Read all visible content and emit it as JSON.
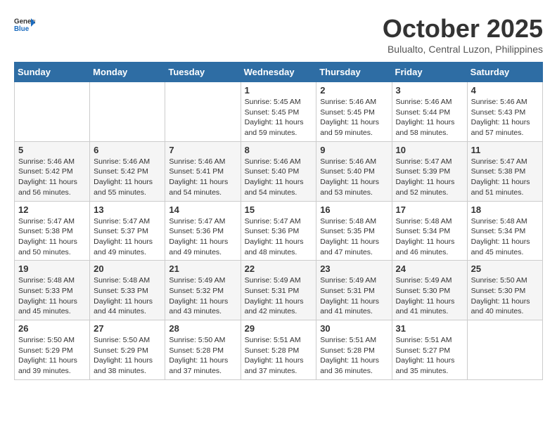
{
  "logo": {
    "general": "General",
    "blue": "Blue"
  },
  "title": "October 2025",
  "subtitle": "Bulualto, Central Luzon, Philippines",
  "weekdays": [
    "Sunday",
    "Monday",
    "Tuesday",
    "Wednesday",
    "Thursday",
    "Friday",
    "Saturday"
  ],
  "weeks": [
    [
      {
        "day": "",
        "info": ""
      },
      {
        "day": "",
        "info": ""
      },
      {
        "day": "",
        "info": ""
      },
      {
        "day": "1",
        "info": "Sunrise: 5:45 AM\nSunset: 5:45 PM\nDaylight: 11 hours\nand 59 minutes."
      },
      {
        "day": "2",
        "info": "Sunrise: 5:46 AM\nSunset: 5:45 PM\nDaylight: 11 hours\nand 59 minutes."
      },
      {
        "day": "3",
        "info": "Sunrise: 5:46 AM\nSunset: 5:44 PM\nDaylight: 11 hours\nand 58 minutes."
      },
      {
        "day": "4",
        "info": "Sunrise: 5:46 AM\nSunset: 5:43 PM\nDaylight: 11 hours\nand 57 minutes."
      }
    ],
    [
      {
        "day": "5",
        "info": "Sunrise: 5:46 AM\nSunset: 5:42 PM\nDaylight: 11 hours\nand 56 minutes."
      },
      {
        "day": "6",
        "info": "Sunrise: 5:46 AM\nSunset: 5:42 PM\nDaylight: 11 hours\nand 55 minutes."
      },
      {
        "day": "7",
        "info": "Sunrise: 5:46 AM\nSunset: 5:41 PM\nDaylight: 11 hours\nand 54 minutes."
      },
      {
        "day": "8",
        "info": "Sunrise: 5:46 AM\nSunset: 5:40 PM\nDaylight: 11 hours\nand 54 minutes."
      },
      {
        "day": "9",
        "info": "Sunrise: 5:46 AM\nSunset: 5:40 PM\nDaylight: 11 hours\nand 53 minutes."
      },
      {
        "day": "10",
        "info": "Sunrise: 5:47 AM\nSunset: 5:39 PM\nDaylight: 11 hours\nand 52 minutes."
      },
      {
        "day": "11",
        "info": "Sunrise: 5:47 AM\nSunset: 5:38 PM\nDaylight: 11 hours\nand 51 minutes."
      }
    ],
    [
      {
        "day": "12",
        "info": "Sunrise: 5:47 AM\nSunset: 5:38 PM\nDaylight: 11 hours\nand 50 minutes."
      },
      {
        "day": "13",
        "info": "Sunrise: 5:47 AM\nSunset: 5:37 PM\nDaylight: 11 hours\nand 49 minutes."
      },
      {
        "day": "14",
        "info": "Sunrise: 5:47 AM\nSunset: 5:36 PM\nDaylight: 11 hours\nand 49 minutes."
      },
      {
        "day": "15",
        "info": "Sunrise: 5:47 AM\nSunset: 5:36 PM\nDaylight: 11 hours\nand 48 minutes."
      },
      {
        "day": "16",
        "info": "Sunrise: 5:48 AM\nSunset: 5:35 PM\nDaylight: 11 hours\nand 47 minutes."
      },
      {
        "day": "17",
        "info": "Sunrise: 5:48 AM\nSunset: 5:34 PM\nDaylight: 11 hours\nand 46 minutes."
      },
      {
        "day": "18",
        "info": "Sunrise: 5:48 AM\nSunset: 5:34 PM\nDaylight: 11 hours\nand 45 minutes."
      }
    ],
    [
      {
        "day": "19",
        "info": "Sunrise: 5:48 AM\nSunset: 5:33 PM\nDaylight: 11 hours\nand 45 minutes."
      },
      {
        "day": "20",
        "info": "Sunrise: 5:48 AM\nSunset: 5:33 PM\nDaylight: 11 hours\nand 44 minutes."
      },
      {
        "day": "21",
        "info": "Sunrise: 5:49 AM\nSunset: 5:32 PM\nDaylight: 11 hours\nand 43 minutes."
      },
      {
        "day": "22",
        "info": "Sunrise: 5:49 AM\nSunset: 5:31 PM\nDaylight: 11 hours\nand 42 minutes."
      },
      {
        "day": "23",
        "info": "Sunrise: 5:49 AM\nSunset: 5:31 PM\nDaylight: 11 hours\nand 41 minutes."
      },
      {
        "day": "24",
        "info": "Sunrise: 5:49 AM\nSunset: 5:30 PM\nDaylight: 11 hours\nand 41 minutes."
      },
      {
        "day": "25",
        "info": "Sunrise: 5:50 AM\nSunset: 5:30 PM\nDaylight: 11 hours\nand 40 minutes."
      }
    ],
    [
      {
        "day": "26",
        "info": "Sunrise: 5:50 AM\nSunset: 5:29 PM\nDaylight: 11 hours\nand 39 minutes."
      },
      {
        "day": "27",
        "info": "Sunrise: 5:50 AM\nSunset: 5:29 PM\nDaylight: 11 hours\nand 38 minutes."
      },
      {
        "day": "28",
        "info": "Sunrise: 5:50 AM\nSunset: 5:28 PM\nDaylight: 11 hours\nand 37 minutes."
      },
      {
        "day": "29",
        "info": "Sunrise: 5:51 AM\nSunset: 5:28 PM\nDaylight: 11 hours\nand 37 minutes."
      },
      {
        "day": "30",
        "info": "Sunrise: 5:51 AM\nSunset: 5:28 PM\nDaylight: 11 hours\nand 36 minutes."
      },
      {
        "day": "31",
        "info": "Sunrise: 5:51 AM\nSunset: 5:27 PM\nDaylight: 11 hours\nand 35 minutes."
      },
      {
        "day": "",
        "info": ""
      }
    ]
  ]
}
